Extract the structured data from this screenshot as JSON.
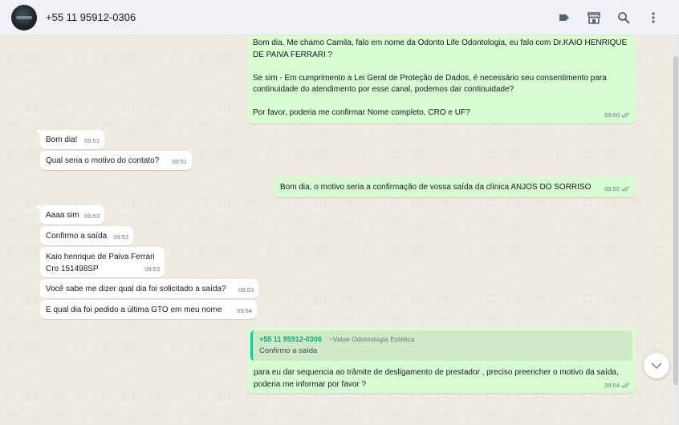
{
  "header": {
    "contact_name": "+55 11 95912-0306",
    "icons": [
      "label-icon",
      "catalog-store-icon",
      "search-icon",
      "menu-kebab-icon"
    ]
  },
  "colors": {
    "outgoing_bubble": "#d9fdd3",
    "incoming_bubble": "#ffffff",
    "chat_background": "#efeae2",
    "quote_accent": "#06cf9c",
    "read_ticks": "#53bdeb"
  },
  "messages": [
    {
      "direction": "out",
      "text": "Bom dia, Me chamo Camila, falo em nome da Odonto Life Odontologia, eu falo com Dr.KAIO HENRIQUE DE PAIVA FERRARI ?\n\nSe sim - Em cumprimento a Lei Geral de Proteção de Dados, é necessário seu consentimento para continuidade do atendimento por esse canal, podemos dar continuidade?\n\nPor favor, poderia me confirmar Nome completo, CRO e UF?",
      "time": "09:50"
    },
    {
      "direction": "in",
      "text": "Bom dia!",
      "time": "09:51"
    },
    {
      "direction": "in",
      "text": "Qual seria o motivo do contato?",
      "time": "09:51"
    },
    {
      "direction": "out",
      "text": "Bom dia, o motivo seria a confirmação de vossa saída da clínica ANJOS DO SORRISO",
      "time": "09:52"
    },
    {
      "direction": "in",
      "text": "Aaaa sim",
      "time": "09:53"
    },
    {
      "direction": "in",
      "text": "Confirmo a saída",
      "time": "09:53"
    },
    {
      "direction": "in",
      "text": "Kaio henrique de Paiva Ferrari\nCro 151498SP",
      "time": "09:53"
    },
    {
      "direction": "in",
      "text": "Você sabe me dizer qual dia foi solicitado a saída?",
      "time": "09:53"
    },
    {
      "direction": "in",
      "text": "E qual dia foi pedido a última GTO em meu nome",
      "time": "09:54"
    },
    {
      "direction": "out",
      "quote": {
        "sender": "+55 11 95912-0306",
        "push_name": "~Value Odontologia Estética",
        "text": "Confirmo a saída"
      },
      "text": "para eu dar sequencia ao trâmite de desligamento de prestador , preciso preencher o motivo da saída, poderia me informar por favor ?",
      "time": "09:54"
    }
  ]
}
